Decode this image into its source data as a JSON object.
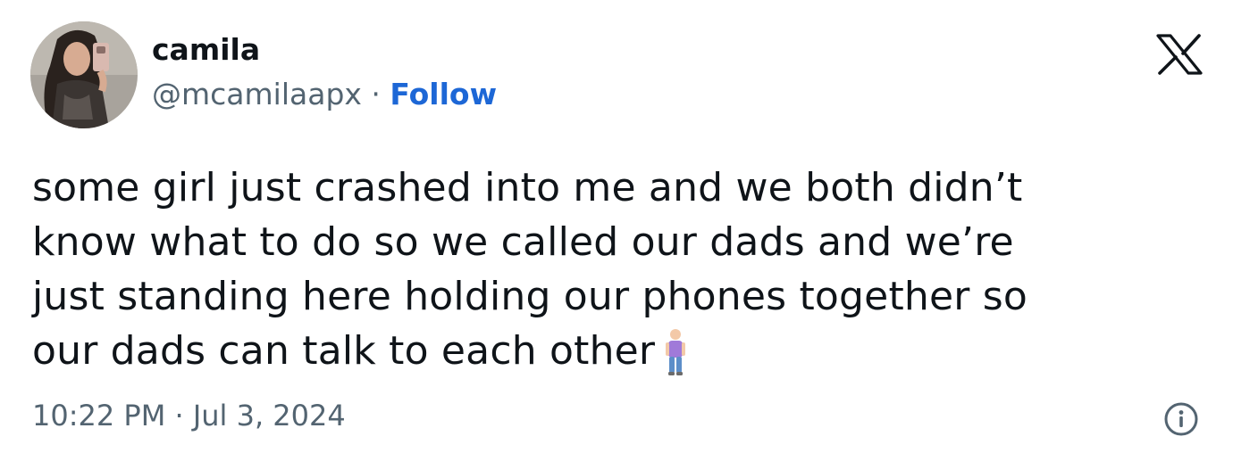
{
  "author": {
    "display_name": "camila",
    "handle": "@mcamilaapx",
    "separator": "·",
    "follow_label": "Follow"
  },
  "post": {
    "lines": [
      "some girl just crashed into me and we both didn’t",
      "know what to do so we called our dads and we’re",
      "just standing here holding our phones together so",
      "our dads can talk to each other"
    ],
    "emoji": "person-standing-emoji"
  },
  "meta": {
    "time": "10:22 PM",
    "separator": "·",
    "date": "Jul 3, 2024"
  },
  "icons": {
    "logo": "x-logo-icon",
    "info": "info-icon"
  },
  "colors": {
    "follow": "#1d67d6",
    "secondary_text": "#536471",
    "primary_text": "#0f1419"
  }
}
